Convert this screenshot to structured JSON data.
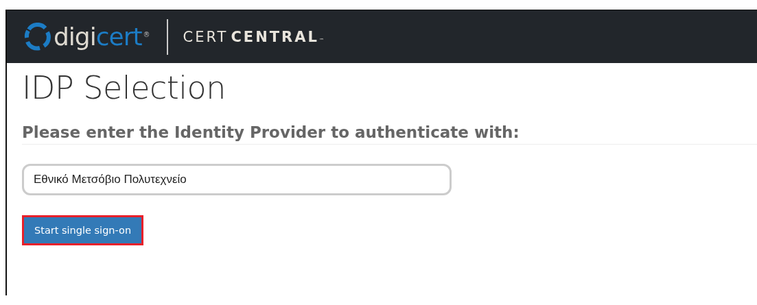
{
  "header": {
    "logo": {
      "first": "digi",
      "second": "cert",
      "mark": "®"
    },
    "product": {
      "light": "CERT",
      "bold": "CENTRAL",
      "mark": "™"
    }
  },
  "title": "IDP Selection",
  "prompt": "Please enter the Identity Provider to authenticate with:",
  "provider_field": {
    "value": "Εθνικό Μετσόβιο Πολυτεχνείο"
  },
  "submit_button": {
    "label": "Start single sign-on",
    "highlighted": true
  }
}
